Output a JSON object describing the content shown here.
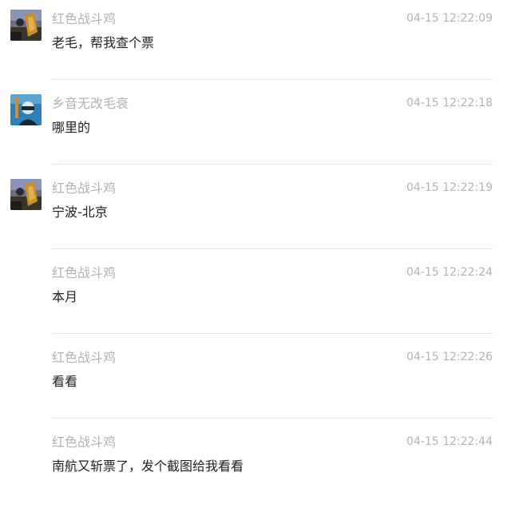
{
  "messages": [
    {
      "sender": "红色战斗鸡",
      "time": "04-15 12:22:09",
      "text": "老毛，帮我查个票",
      "avatar": "avatar-red-fighting-chicken"
    },
    {
      "sender": "乡音无改毛衰",
      "time": "04-15 12:22:18",
      "text": "哪里的",
      "avatar": "avatar-xiangyin"
    },
    {
      "sender": "红色战斗鸡",
      "time": "04-15 12:22:19",
      "text": "宁波-北京",
      "avatar": "avatar-red-fighting-chicken"
    },
    {
      "sender": "红色战斗鸡",
      "time": "04-15 12:22:24",
      "text": "本月",
      "avatar": null
    },
    {
      "sender": "红色战斗鸡",
      "time": "04-15 12:22:26",
      "text": "看看",
      "avatar": null
    },
    {
      "sender": "红色战斗鸡",
      "time": "04-15 12:22:44",
      "text": "南航又斩票了，发个截图给我看看",
      "avatar": null
    }
  ]
}
